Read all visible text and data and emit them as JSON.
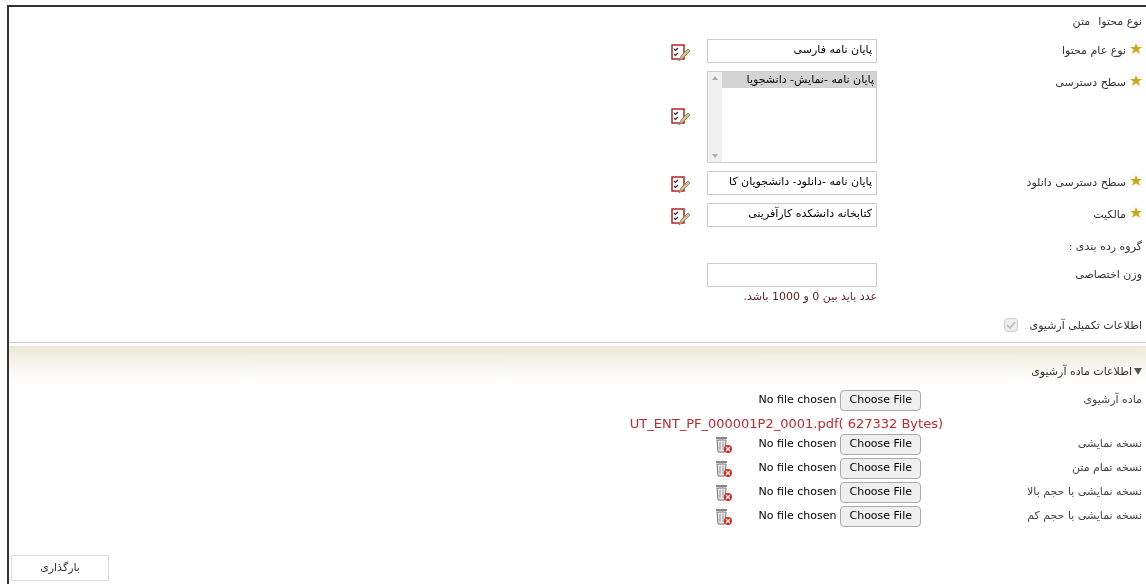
{
  "fields": [
    {
      "kind": "static",
      "label": "نوع محتوا",
      "value": "متن"
    },
    {
      "kind": "text",
      "required": true,
      "label": "نوع عام محتوا",
      "value": "پایان نامه فارسی",
      "editable": true
    },
    {
      "kind": "listbox",
      "required": true,
      "label": "سطح دسترسی",
      "options": [
        {
          "label": "پایان نامه -نمایش- دانشجویا",
          "selected": true
        }
      ],
      "editable": true
    },
    {
      "kind": "text",
      "required": true,
      "label": "سطح دسترسی دانلود",
      "value": "پایان نامه -دانلود- دانشجویان کا",
      "editable": true
    },
    {
      "kind": "text",
      "required": true,
      "label": "مالکیت",
      "value": "کتابخانه دانشکده کارآفرینی",
      "editable": true
    },
    {
      "kind": "static",
      "label": "گروه رده بندی :"
    },
    {
      "kind": "number",
      "required": false,
      "label": "وزن اختصاصی",
      "hint": "عدد باید بین 0 و 1000 باشد."
    },
    {
      "kind": "checkbox",
      "label": "اطلاعات تکمیلی آرشیوی",
      "checked": true,
      "disabled": true
    }
  ],
  "section": {
    "title": "اطلاعات ماده آرشیوی",
    "expanded": true
  },
  "files": [
    {
      "label": "ماده آرشیوی",
      "button": "Choose File",
      "status": "No file chosen",
      "deletable": false
    },
    {
      "label": "نسخه نمایشی",
      "attached": "UT_ENT_PF_000001P2_0001.pdf( 627332 Bytes)",
      "button": "Choose File",
      "status": "No file chosen",
      "deletable": true
    },
    {
      "label": "نسخه تمام متن",
      "button": "Choose File",
      "status": "No file chosen",
      "deletable": true
    },
    {
      "label": "نسخه نمایشی با حجم بالا",
      "button": "Choose File",
      "status": "No file chosen",
      "deletable": true
    },
    {
      "label": "نسخه نمایشی با حجم کم",
      "button": "Choose File",
      "status": "No file chosen",
      "deletable": true
    }
  ],
  "submit": "بارگذاری"
}
